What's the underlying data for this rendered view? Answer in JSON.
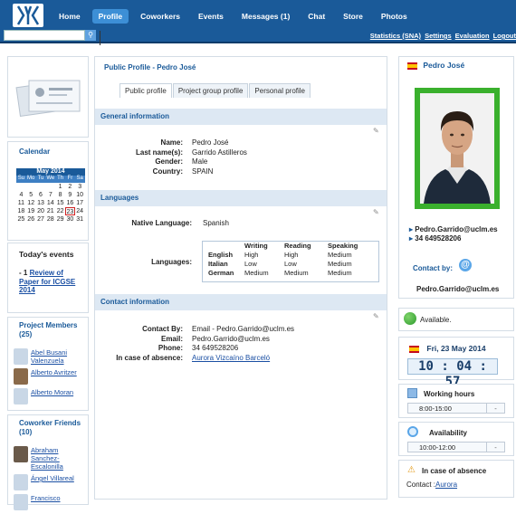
{
  "nav": {
    "items": [
      "Home",
      "Profile",
      "Coworkers",
      "Events",
      "Messages (1)",
      "Chat",
      "Store",
      "Photos"
    ],
    "active_index": 1
  },
  "toplinks": [
    "Statistics (SNA)",
    "Settings",
    "Evaluation",
    "Logout"
  ],
  "calendar": {
    "title": "Calendar",
    "month": "May 2014",
    "day_headers": [
      "Su",
      "Mo",
      "Tu",
      "We",
      "Th",
      "Fr",
      "Sa"
    ],
    "weeks": [
      [
        "",
        "",
        "",
        "",
        "1",
        "2",
        "3"
      ],
      [
        "4",
        "5",
        "6",
        "7",
        "8",
        "9",
        "10"
      ],
      [
        "11",
        "12",
        "13",
        "14",
        "15",
        "16",
        "17"
      ],
      [
        "18",
        "19",
        "20",
        "21",
        "22",
        "23",
        "24"
      ],
      [
        "25",
        "26",
        "27",
        "28",
        "29",
        "30",
        "31"
      ]
    ],
    "today": "23"
  },
  "todays_events": {
    "title": "Today's events",
    "count": "1",
    "event_prefix": "- 1",
    "event_link": "Review of Paper for ICGSE 2014"
  },
  "project_members": {
    "title": "Project Members (25)",
    "members": [
      "Abel Busani Valenzuela",
      "Alberto Avritzer",
      "Alberto Moran"
    ]
  },
  "coworker_friends": {
    "title": "Coworker Friends (10)",
    "friends": [
      "Abraham Sanchez-Escalonilla",
      "Ángel Villareal",
      "Francisco"
    ]
  },
  "profile": {
    "heading": "Public Profile - Pedro José",
    "tabs": [
      "Public profile",
      "Project group profile",
      "Personal profile"
    ],
    "general": {
      "title": "General information",
      "rows": [
        {
          "label": "Name:",
          "value": "Pedro José"
        },
        {
          "label": "Last name(s):",
          "value": "Garrido Astilleros"
        },
        {
          "label": "Gender:",
          "value": "Male"
        },
        {
          "label": "Country:",
          "value": "SPAIN"
        }
      ]
    },
    "languages": {
      "title": "Languages",
      "native_label": "Native Language:",
      "native_value": "Spanish",
      "languages_label": "Languages:",
      "table_headers": [
        "",
        "Writing",
        "Reading",
        "Speaking"
      ],
      "table_rows": [
        [
          "English",
          "High",
          "High",
          "Medium"
        ],
        [
          "Italian",
          "Low",
          "Low",
          "Medium"
        ],
        [
          "German",
          "Medium",
          "Medium",
          "Medium"
        ]
      ]
    },
    "contact": {
      "title": "Contact information",
      "rows": [
        {
          "label": "Contact By:",
          "value": "Email - Pedro.Garrido@uclm.es"
        },
        {
          "label": "Email:",
          "value": "Pedro.Garrido@uclm.es"
        },
        {
          "label": "Phone:",
          "value": "34 649528206"
        },
        {
          "label": "In case of absence:",
          "value": "Aurora Vizcaíno Barceló"
        }
      ]
    }
  },
  "right": {
    "name": "Pedro José",
    "email": "Pedro.Garrido@uclm.es",
    "phone": "34 649528206",
    "contact_by_label": "Contact by:",
    "contact_email": "Pedro.Garrido@uclm.es",
    "status": "Available.",
    "date": "Fri, 23 May 2014",
    "time": "10 : 04 : 57",
    "working_hours_label": "Working hours",
    "working_hours_value": "8:00-15:00",
    "availability_label": "Availability",
    "availability_value": "10:00-12:00",
    "absence_label": "In case of absence",
    "absence_contact_prefix": "Contact :",
    "absence_contact_link": "Aurora"
  },
  "colors": {
    "topbar": "#1a5a99",
    "accent": "#3d8fd6",
    "photo_border": "#3ab02d",
    "status_green": "#2e9a2e"
  }
}
